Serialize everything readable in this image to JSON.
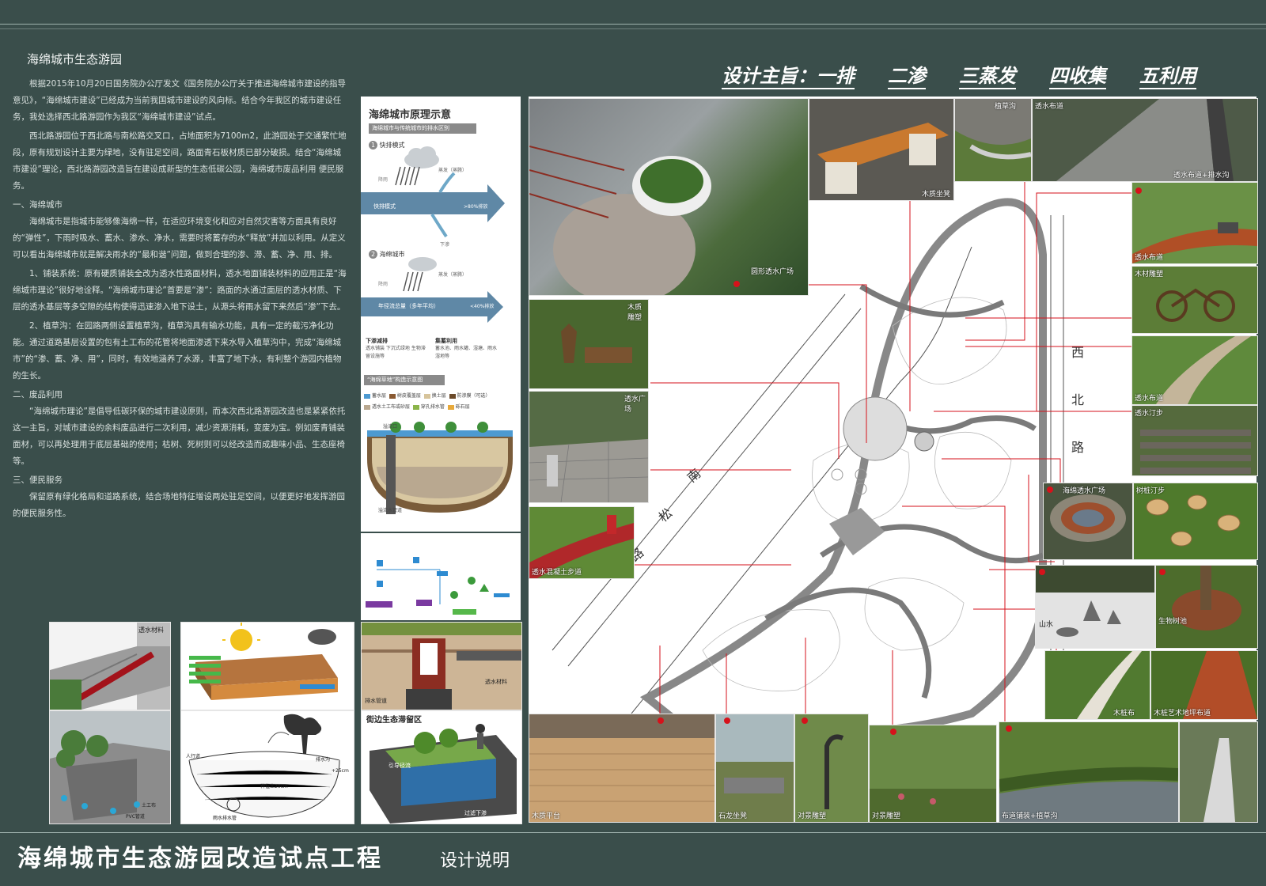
{
  "project_title": "海绵城市生态游园",
  "intro": {
    "paragraphs": [
      "根据2015年10月20日国务院办公厅发文《国务院办公厅关于推进海绵城市建设的指导意见》，“海绵城市建设”已经成为当前我国城市建设的风向标。结合今年我区的城市建设任务，我处选择西北路游园作为我区“海绵城市建设”试点。",
      "西北路游园位于西北路与南松路交叉口，占地面积为7100m2，此游园处于交通繁忙地段，原有规划设计主要为绿地，没有驻足空间，路面青石板材质已部分破损。结合“海绵城市建设”理论，西北路游园改造旨在建设成新型的生态低碳公园，海绵城市废品利用 便民服务。"
    ],
    "h1": "一、海绵城市",
    "p3": "海绵城市是指城市能够像海绵一样，在适应环境变化和应对自然灾害等方面具有良好的“弹性”，下雨时吸水、蓄水、渗水、净水，需要时将蓄存的水“释放”并加以利用。从定义可以看出海绵城市就是解决雨水的“最和谐”问题，做到合理的渗、滞、蓄、净、用、排。",
    "p4": "1、铺装系统：原有硬质铺装全改为透水性路面材料，透水地面铺装材料的应用正是“海绵城市理论”很好地诠释。“海绵城市理论”首要是“渗”：路面的水通过面层的透水材质、下层的透水基层等多空隙的结构使得迅速渗入地下设土，从源头将雨水留下来然后“渗”下去。",
    "p5": "2、植草沟：在园路两侧设置植草沟，植草沟具有输水功能，具有一定的截污净化功能。通过道路基层设置的包有土工布的花管将地面渗透下来水导入植草沟中，完成“海绵城市”的“渗、蓄、净、用”，同时，有效地涵养了水源，丰富了地下水，有利整个游园内植物的生长。",
    "h2": "二、废品利用",
    "p6": "“海绵城市理论”是倡导低碳环保的城市建设原则，而本次西北路游园改造也是紧紧依托这一主旨，对城市建设的余料废品进行二次利用，减少资源消耗，变废为宝。例如废青铺装面材，可以再处理用于底层基础的使用；枯树、死树则可以经改造而成趣味小品、生态座椅等。",
    "h3": "三、便民服务",
    "p7": "保留原有绿化格局和道路系统，结合场地特征增设两处驻足空间，以便更好地发挥游园的便民服务性。"
  },
  "theme": {
    "prefix": "设计主旨：一排",
    "items": [
      "二渗",
      "三蒸发",
      "四收集",
      "五利用"
    ]
  },
  "principle": {
    "title": "海绵城市原理示意",
    "subtitle": "海绵城市与传统城市的排水区别",
    "mode1": "快排模式",
    "mode1_bar": "快排模式",
    "mode1_pct": ">80%排放",
    "rain": "降雨",
    "evap": "蒸发（蒸腾）",
    "down": "下渗",
    "mode2": "海绵城市",
    "mode2_bar": "年径流总量（多年平均）",
    "mode2_pct": "<40%排放",
    "infil_title": "下渗减排",
    "infil_text": "透水铺装 下沉式绿地 生物滞留设施等",
    "collect_title": "集蓄利用",
    "collect_text": "蓄水池、雨水罐、湿塘、雨水湿地等",
    "section_title": "“海绵草地”构造示意图",
    "legend": [
      "蓄水层",
      "树皮覆盖层",
      "换土层",
      "防渗膜（可选）",
      "透水土工布或砂层",
      "穿孔排水管",
      "砾石层"
    ],
    "overflow": "溢流口",
    "drain_pipe": "溢流水管道"
  },
  "map": {
    "road_xibei": [
      "西",
      "北",
      "路"
    ],
    "road_nansong": [
      "南",
      "松",
      "路"
    ]
  },
  "photos": {
    "plaza": "圆形透水广场",
    "bench": "木质坐凳",
    "ditch": "植草沟",
    "permeable": "透水布道",
    "permeable_full": "透水布道+排水沟",
    "pavement1": "透水布道",
    "sculpture_wood": "木材雕塑",
    "sculpture_man": "木质雕塑",
    "pavement2": "透水布道",
    "stepping": "透水汀步",
    "square": "透水广场",
    "ring": "海绵透水广场",
    "stumps": "树桩汀步",
    "red_path": "透水混凝土步道",
    "rockery": "山水",
    "tree_pool": "生物树池",
    "wood_path": "木桩布",
    "art_path": "木桩艺术地坪布道",
    "deck": "木质平台",
    "stone_seat": "石龙坐凳",
    "sculpture3": "对景雕塑",
    "sculpture4": "对景雕塑",
    "path_ditch": "布道铺装+植草沟"
  },
  "details": {
    "perm_material": "透水材料",
    "drain_pipe": "排水管道",
    "perm_material2": "透水材料",
    "street_title": "街边生态滞留区",
    "guide": "引导径流",
    "filter": "过滤下渗",
    "sidewalk": "人行道",
    "depth1": "种植土20cm",
    "depth2": "排水沟",
    "depth3": "+25cm",
    "pipe": "雨水排水管",
    "pvc": "PVC管道",
    "geo": "土工布"
  },
  "footer": {
    "title": "海绵城市生态游园改造试点工程",
    "subtitle": "设计说明"
  }
}
